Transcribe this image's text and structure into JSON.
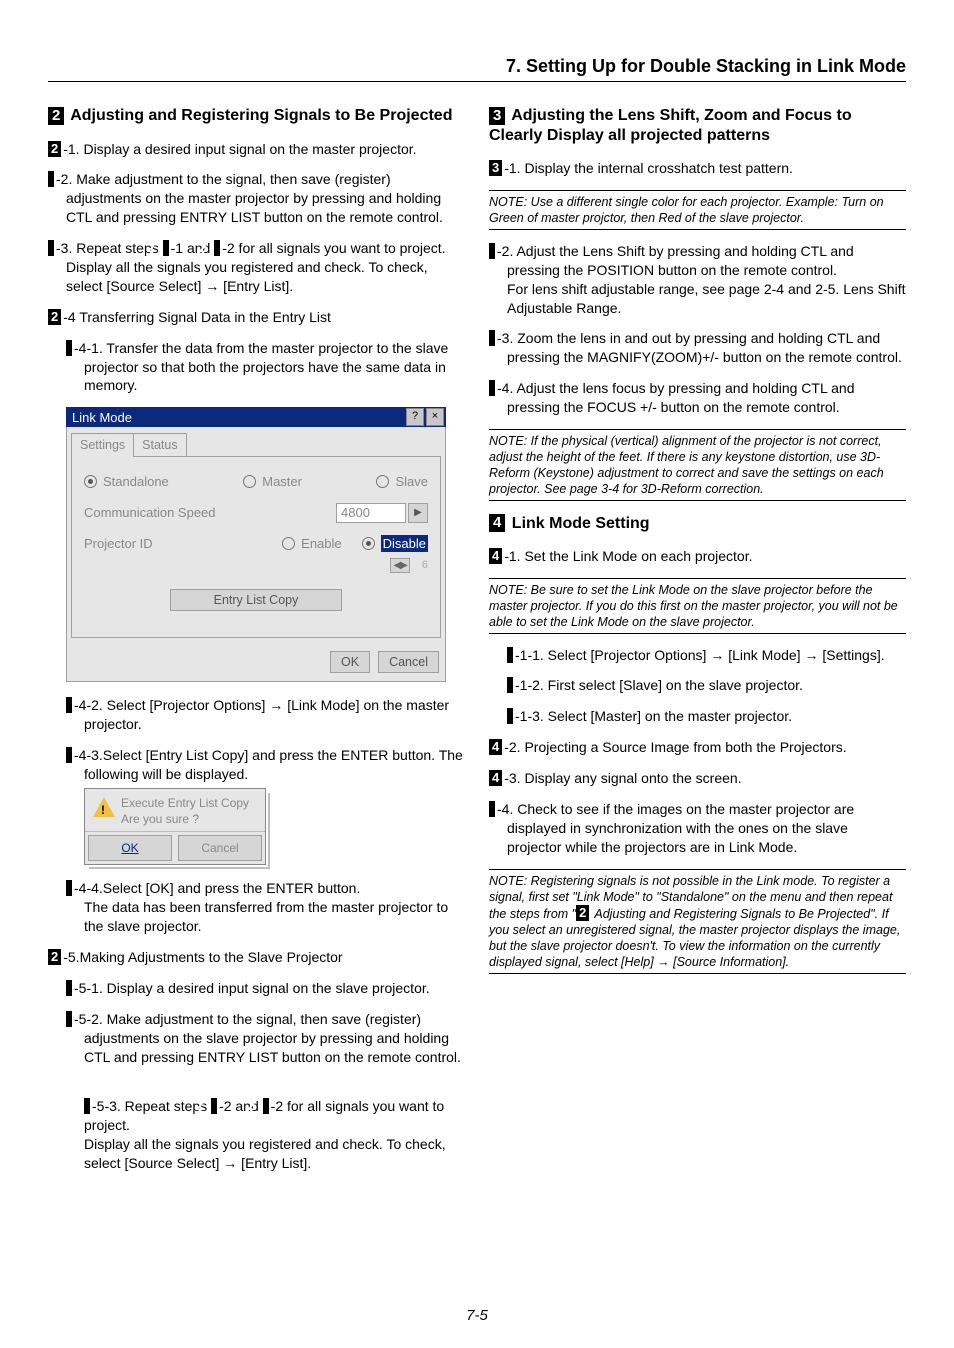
{
  "chapter_title": "7. Setting Up for Double Stacking in Link Mode",
  "page_number": "7-5",
  "left": {
    "sec2_title": " Adjusting and Registering Signals to Be Projected",
    "p2_1": "-1. Display a desired input signal on the master projector.",
    "p2_2": "-2. Make adjustment to the signal, then save (register) adjustments on the master projector by pressing and holding CTL and pressing ENTRY LIST button on the remote control.",
    "p2_3_a": "-3. Repeat steps ",
    "p2_3_b": "-1 and ",
    "p2_3_c": "-2 for all signals you want to project. Display all the signals you registered and check. To check, select [Source Select] → [Entry List].",
    "p2_4": "-4 Transferring Signal Data in the Entry List",
    "p2_4_1": "-4-1. Transfer the data from the master projector to the slave projector so that both the projectors have the same data in memory.",
    "p2_4_2": "-4-2. Select [Projector Options] → [Link Mode] on the master projector.",
    "p2_4_3": "-4-3.Select [Entry List Copy] and press the ENTER button. The following will be displayed.",
    "p2_4_4": "-4-4.Select [OK] and press the ENTER button.\nThe data has been transferred from the master projector to the slave projector.",
    "p2_5": "-5.Making Adjustments to the Slave Projector",
    "p2_5_1": "-5-1. Display a desired input signal on the slave projector.",
    "p2_5_2": "-5-2. Make adjustment to the signal, then save (register) adjustments on the slave projector by pressing and holding CTL and pressing ENTRY LIST button on the remote control.",
    "p2_5_3_a": "-5-3. Repeat steps ",
    "p2_5_3_b": "-2 and ",
    "p2_5_3_c": "-2 for all signals you want to project.\nDisplay all the signals you registered and check. To check, select [Source Select] → [Entry List].",
    "dialog": {
      "title": "Link Mode",
      "tabs": {
        "settings": "Settings",
        "status": "Status"
      },
      "radios": {
        "standalone": "Standalone",
        "master": "Master",
        "slave": "Slave"
      },
      "comm_label": "Communication Speed",
      "comm_value": "4800",
      "proj_label": "Projector ID",
      "enable": "Enable",
      "disable": "Disable",
      "id_arrows_end": "6",
      "entry_copy": "Entry List Copy",
      "ok": "OK",
      "cancel": "Cancel"
    },
    "confirm": {
      "line1": "Execute Entry List Copy",
      "line2": "Are you sure ?",
      "ok": "OK",
      "cancel": "Cancel"
    }
  },
  "right": {
    "sec3_title": " Adjusting the Lens Shift, Zoom and Focus to Clearly Display all projected patterns",
    "p3_1": "-1. Display the internal crosshatch test pattern.",
    "note3a": "NOTE: Use a different single color for each projector. Example: Turn on Green of master projctor, then Red of the slave projector.",
    "p3_2": "-2. Adjust the Lens Shift by pressing and holding CTL and pressing the POSITION button on the remote control.\nFor lens shift adjustable range, see page 2-4 and 2-5. Lens Shift Adjustable Range.",
    "p3_3": "-3. Zoom the lens in and out by pressing and holding CTL and pressing the MAGNIFY(ZOOM)+/- button on the remote control.",
    "p3_4": "-4. Adjust the lens focus by pressing and holding CTL and pressing the FOCUS +/- button on the remote control.",
    "note3b": "NOTE: If the physical (vertical) alignment of the projector is not correct, adjust the height of the feet. If there is any keystone distortion, use 3D-Reform (Keystone) adjustment to correct and save the settings on each projector. See page 3-4 for 3D-Reform correction.",
    "sec4_title": " Link Mode Setting",
    "p4_1": "-1. Set the Link Mode on each projector.",
    "note4a": "NOTE: Be sure to set the Link Mode on the slave projector before the master projector. If you do this first on the master projector, you will not be able to set the Link Mode on the slave projector.",
    "p4_1_1": "-1-1. Select [Projector Options] → [Link Mode] → [Settings].",
    "p4_1_2": "-1-2. First select [Slave] on the slave projector.",
    "p4_1_3": "-1-3. Select [Master] on the master projector.",
    "p4_2": "-2. Projecting a Source Image from both the Projectors.",
    "p4_3": "-3. Display any signal onto the screen.",
    "p4_4": "-4. Check to see if the images on the master projector are displayed in synchronization with the ones on the slave projector while the projectors are in Link Mode.",
    "note4b_a": "NOTE: Registering signals is not possible in the Link mode. To register a signal, first set \"Link Mode\" to \"Standalone\" on the menu and then repeat the steps from \"",
    "note4b_b": " Adjusting and Registering Signals to Be Projected\". If you select an unregistered signal, the master projector displays the image, but the slave projector doesn't. To view the information on the currently displayed signal, select [Help] → [Source Information]."
  }
}
